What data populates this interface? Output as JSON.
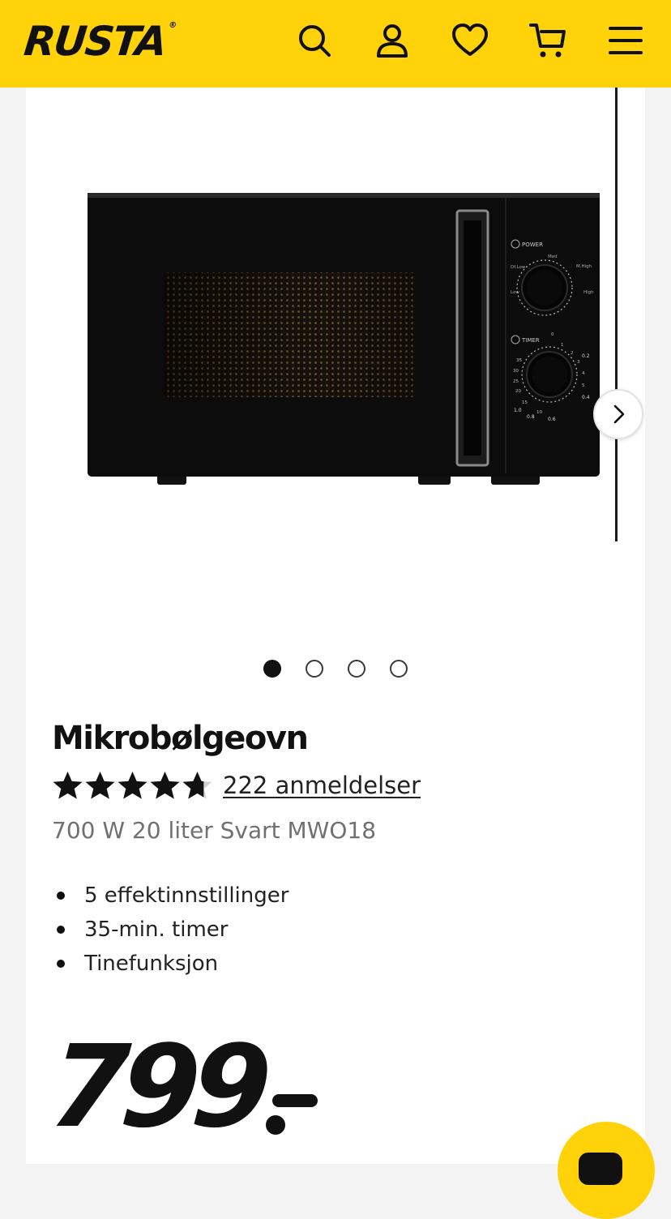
{
  "header": {
    "logo": "RUSTA",
    "logo_mark": "®",
    "icons": [
      "search-icon",
      "account-icon",
      "heart-icon",
      "cart-icon",
      "menu-icon"
    ],
    "background": "#ffd20a"
  },
  "gallery": {
    "slide_count": 4,
    "active_slide": 1
  },
  "product": {
    "title": "Mikrobølgeovn",
    "rating_value": 4.7,
    "rating_max": 5,
    "reviews": "222 anmeldelser",
    "subtitle": "700 W 20 liter Svart MWO18",
    "features": [
      "5 effektinnstillinger",
      "35-min. timer",
      "Tinefunksjon"
    ],
    "price": "799"
  },
  "microwave": {
    "power_label": "POWER",
    "timer_label": "TIMER",
    "power_settings": [
      "Low",
      "Df.Low",
      "Med",
      "M.High",
      "High"
    ],
    "timer_marks": [
      "0",
      "1",
      "2",
      "3",
      "4",
      "5",
      "10",
      "15",
      "20",
      "25",
      "30",
      "35"
    ],
    "weight_marks": [
      "0.2",
      "0.4",
      "0.6",
      "0.8",
      "1.0"
    ]
  }
}
